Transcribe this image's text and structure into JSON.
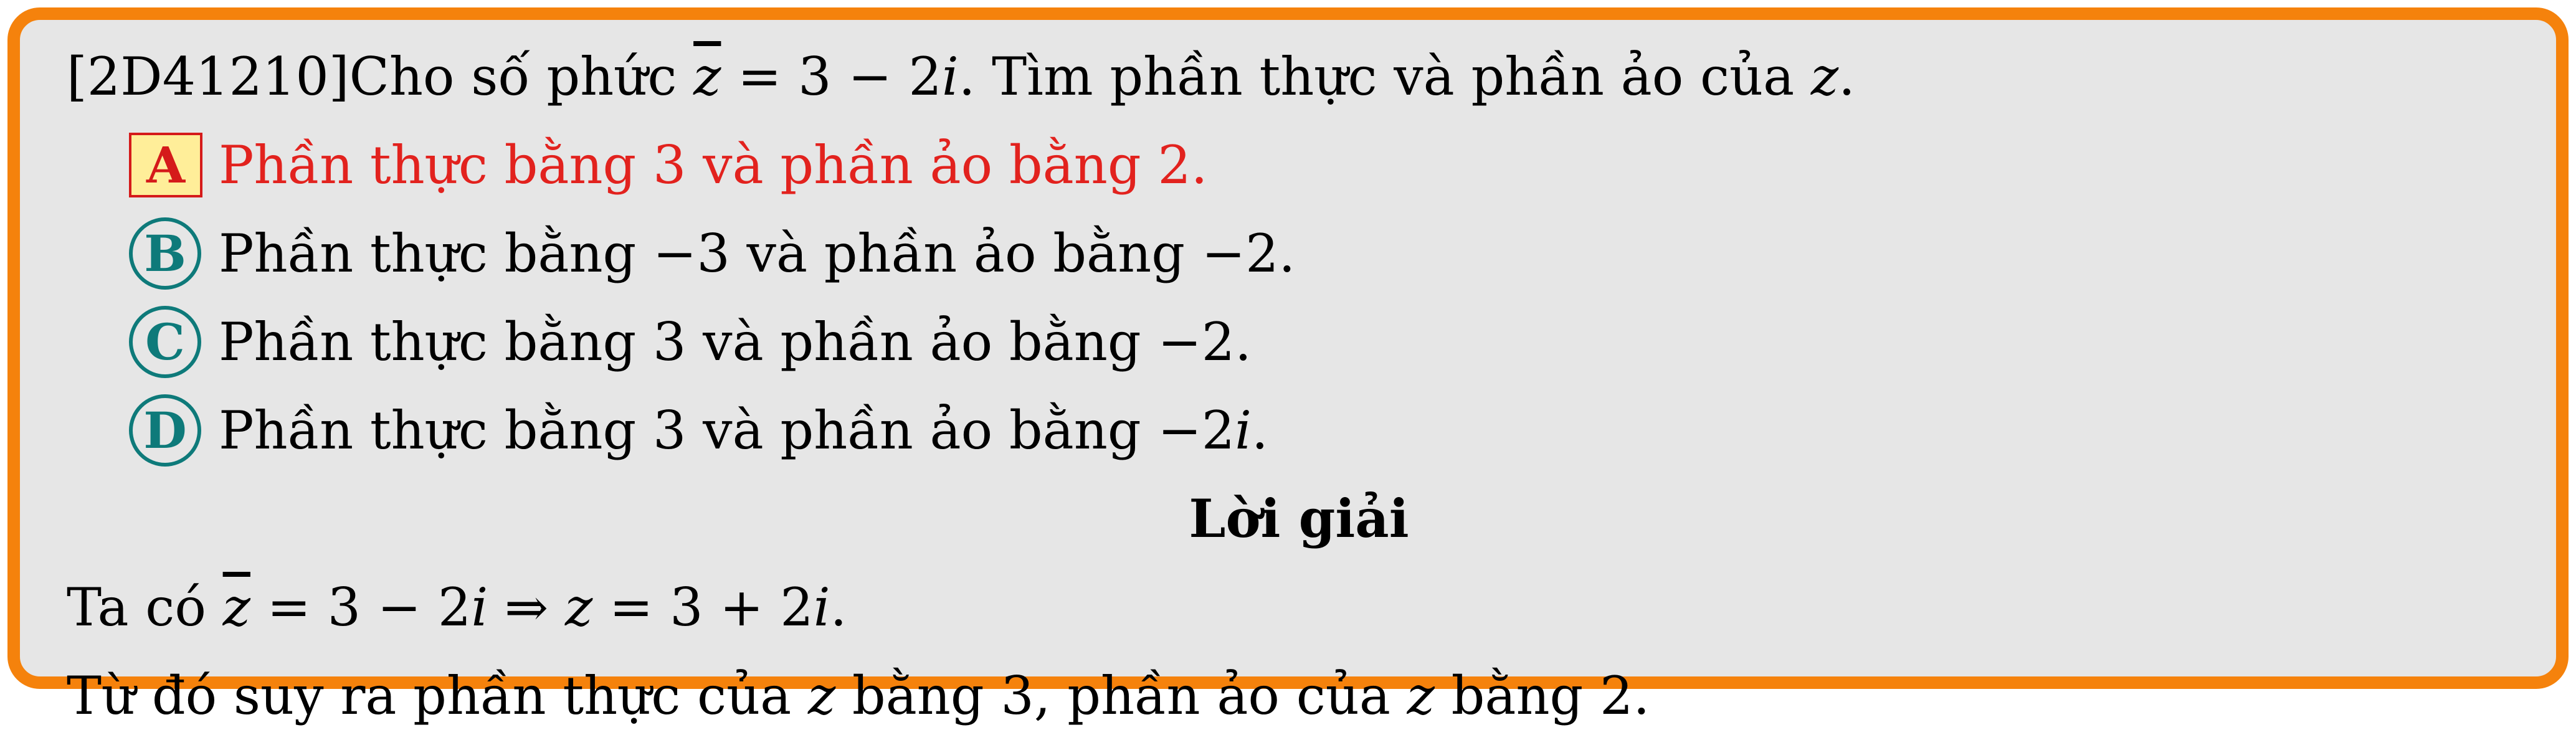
{
  "question": {
    "id": "[2D41210]",
    "prefix": "Cho số phức ",
    "zbar": "z",
    "expr": " = 3 − 2",
    "i": "i",
    "suffix": ". Tìm phần thực và phần ảo của ",
    "z": "z",
    "end": "."
  },
  "options": [
    {
      "label": "A",
      "text": "Phần thực bằng 3 và phần ảo bằng 2.",
      "correct": true
    },
    {
      "label": "B",
      "text": "Phần thực bằng −3 và phần ảo bằng −2.",
      "correct": false
    },
    {
      "label": "C",
      "text": "Phần thực bằng 3 và phần ảo bằng −2.",
      "correct": false
    },
    {
      "label": "D",
      "text_pre": "Phần thực bằng 3 và phần ảo bằng −2",
      "text_i": "i",
      "text_end": ".",
      "correct": false
    }
  ],
  "solution": {
    "heading": "Lời giải",
    "line1": {
      "pre": "Ta có ",
      "zbar": "z",
      "mid": " = 3 − 2",
      "i": "i",
      "arrow": " ⇒ ",
      "z": "z",
      "eq": " = 3 + 2",
      "i2": "i",
      "end": "."
    },
    "line2": {
      "pre": "Từ đó suy ra phần thực của ",
      "z1": "z",
      "mid": " bằng 3, phần ảo của ",
      "z2": "z",
      "end": " bằng 2."
    }
  },
  "colors": {
    "frame": "#f5820c",
    "background": "#e6e6e6",
    "correct": "#e2221e",
    "option_circle": "#0e7a7a"
  }
}
